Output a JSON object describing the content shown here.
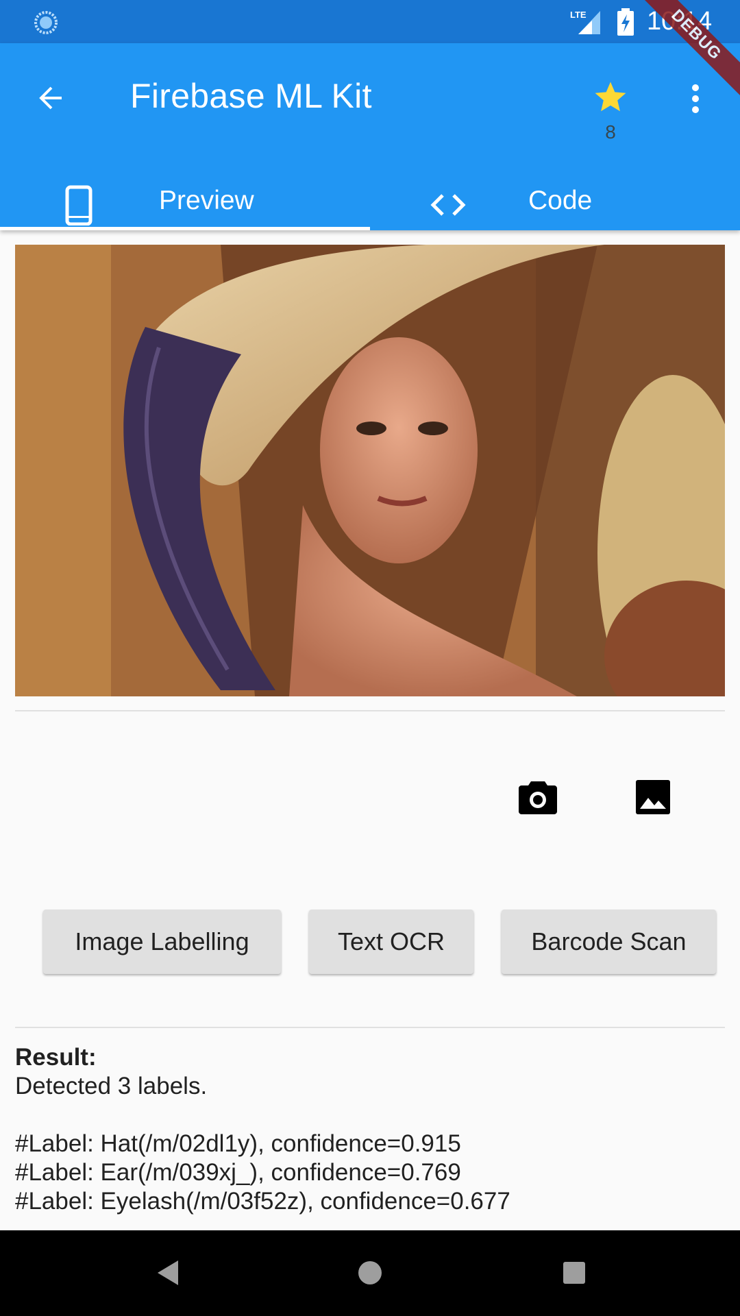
{
  "status_bar": {
    "time": "10:14",
    "network": "LTE"
  },
  "app_bar": {
    "title": "Firebase ML Kit",
    "star_count": "8",
    "debug_banner": "DEBUG"
  },
  "tabs": [
    {
      "label": "Preview",
      "icon": "phone-icon",
      "selected": true
    },
    {
      "label": "Code",
      "icon": "code-icon",
      "selected": false
    }
  ],
  "buttons": {
    "image_labelling": "Image Labelling",
    "text_ocr": "Text OCR",
    "barcode_scan": "Barcode Scan"
  },
  "result": {
    "title": "Result:",
    "summary": "Detected 3 labels.",
    "labels": [
      "#Label: Hat(/m/02dl1y), confidence=0.915",
      "#Label: Ear(/m/039xj_), confidence=0.769",
      "#Label: Eyelash(/m/03f52z), confidence=0.677"
    ]
  },
  "colors": {
    "status_bar": "#1976d2",
    "app_bar": "#2196f3",
    "star": "#fdd835",
    "button": "#e0e0e0",
    "debug_ribbon": "#8b1a1a"
  }
}
